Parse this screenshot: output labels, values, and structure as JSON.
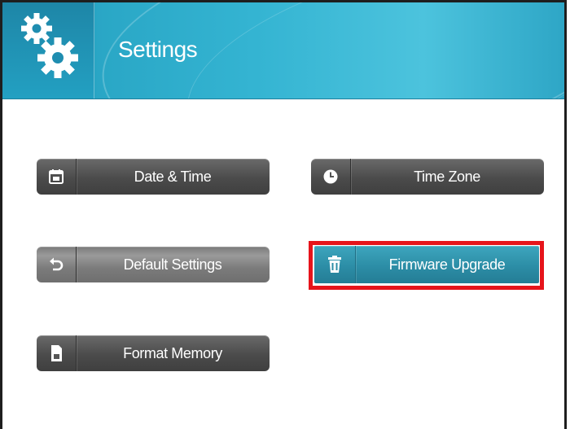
{
  "header": {
    "title": "Settings",
    "icon": "gears-icon"
  },
  "buttons": [
    {
      "id": "date-time",
      "label": "Date & Time",
      "icon": "calendar-icon"
    },
    {
      "id": "time-zone",
      "label": "Time Zone",
      "icon": "clock-icon"
    },
    {
      "id": "default-settings",
      "label": "Default Settings",
      "icon": "reset-arrow-icon"
    },
    {
      "id": "firmware-upgrade",
      "label": "Firmware Upgrade",
      "icon": "trash-icon",
      "selected": true
    },
    {
      "id": "format-memory",
      "label": "Format Memory",
      "icon": "memory-card-icon"
    }
  ],
  "colors": {
    "header_gradient_start": "#1f8fb1",
    "header_gradient_end": "#4cc3dd",
    "button_dark": "#4b4b4b",
    "button_selected": "#2c8da6",
    "highlight_border": "#e6141b"
  }
}
